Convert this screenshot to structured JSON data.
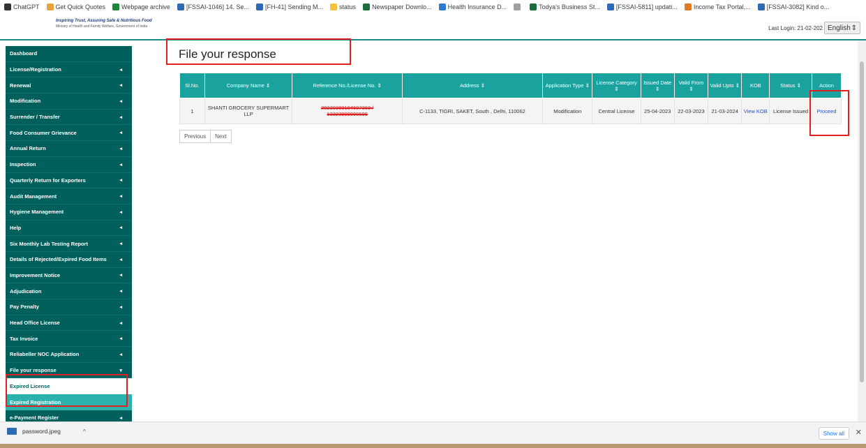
{
  "bookmarks": [
    {
      "label": "ChatGPT",
      "color": "#333333",
      "icon": "chatgpt-icon"
    },
    {
      "label": "Get Quick Quotes",
      "color": "#e8a33d",
      "icon": "quotes-icon"
    },
    {
      "label": "Webpage archive",
      "color": "#1a8a3a",
      "icon": "archive-icon"
    },
    {
      "label": "[FSSAI-1046] 14. Se...",
      "color": "#2f6bb5",
      "icon": "jira-icon"
    },
    {
      "label": "[FH-41] Sending M...",
      "color": "#2f6bb5",
      "icon": "jira-icon"
    },
    {
      "label": "status",
      "color": "#f3c33b",
      "icon": "folder-icon"
    },
    {
      "label": "Newspaper Downlo...",
      "color": "#1a6e3a",
      "icon": "newspaper-icon"
    },
    {
      "label": "Health Insurance D...",
      "color": "#2e7ad1",
      "icon": "health-icon"
    },
    {
      "label": "",
      "color": "#a0a0a0",
      "icon": "chart-icon"
    },
    {
      "label": "Todya's Business St...",
      "color": "#1a6e3a",
      "icon": "business-icon"
    },
    {
      "label": "[FSSAI-5811] updati...",
      "color": "#2f6bb5",
      "icon": "jira-icon"
    },
    {
      "label": "Income Tax Portal,...",
      "color": "#e07a20",
      "icon": "tax-icon"
    },
    {
      "label": "[FSSAI-3082] Kind o...",
      "color": "#2f6bb5",
      "icon": "jira-icon"
    }
  ],
  "header": {
    "tagline": "Inspiring Trust, Assuring Safe & Nutritious Food",
    "ministry": "Ministry of Health and Family Welfare, Government of India",
    "last_login": "Last Login: 21-02-202",
    "language": "English"
  },
  "sidebar": {
    "items": [
      {
        "label": "Dashboard",
        "arrow": ""
      },
      {
        "label": "License/Registration",
        "arrow": "◂"
      },
      {
        "label": "Renewal",
        "arrow": "◂"
      },
      {
        "label": "Modification",
        "arrow": "◂"
      },
      {
        "label": "Surrender / Transfer",
        "arrow": "◂"
      },
      {
        "label": "Food Consumer Grievance",
        "arrow": "◂"
      },
      {
        "label": "Annual Return",
        "arrow": "◂"
      },
      {
        "label": "Inspection",
        "arrow": "◂"
      },
      {
        "label": "Quarterly Return for Exporters",
        "arrow": "◂"
      },
      {
        "label": "Audit Management",
        "arrow": "◂"
      },
      {
        "label": "Hygiene Management",
        "arrow": "◂"
      },
      {
        "label": "Help",
        "arrow": "◂"
      },
      {
        "label": "Six Monthly Lab Testing Report",
        "arrow": "◂"
      },
      {
        "label": "Details of Rejected/Expired Food Items",
        "arrow": "◂"
      },
      {
        "label": "Improvement Notice",
        "arrow": "◂"
      },
      {
        "label": "Adjudication",
        "arrow": "◂"
      },
      {
        "label": "Pay Penalty",
        "arrow": "◂"
      },
      {
        "label": "Head Office License",
        "arrow": "◂"
      },
      {
        "label": "Tax Invoice",
        "arrow": "◂"
      },
      {
        "label": "Reliabeller NOC Application",
        "arrow": "◂"
      },
      {
        "label": "File your response",
        "arrow": "▾"
      }
    ],
    "sub_items": [
      "Expired License",
      "Expired Registration"
    ],
    "last_item": {
      "label": "e-Payment Register",
      "arrow": "◂"
    }
  },
  "main": {
    "title": "File your response",
    "columns": [
      "Sl.No.",
      "Company Name ⇕",
      "Reference No./License No. ⇕",
      "Address ⇕",
      "Application Type ⇕",
      "License Category ⇕",
      "Issued Date ⇕",
      "Valid From ⇕",
      "Valid Upto ⇕",
      "KOB",
      "Status ⇕",
      "Action"
    ],
    "row": {
      "sl_no": "1",
      "company": "SHANTI GROCERY SUPERMART LLP",
      "reference": "20230309104607303 /",
      "license": "13323999000609",
      "address": "C-1133, TIGRI, SAKET, South , Delhi, 110062",
      "app_type": "Modification",
      "category": "Central License",
      "issued": "25-04-2023",
      "valid_from": "22-03-2023",
      "valid_upto": "21-03-2024",
      "kob": "View KOB",
      "status": "License Issued",
      "action": "Proceed"
    },
    "pager": {
      "previous": "Previous",
      "next": "Next"
    }
  },
  "downloads": {
    "file": "password.jpeg",
    "show_all": "Show all",
    "close": "✕",
    "chevron": "^"
  },
  "colors": {
    "sidebar": "#01605c",
    "table_header": "#1aa39e",
    "highlight_red": "#e02020",
    "active_sub": "#2bb2ad"
  }
}
